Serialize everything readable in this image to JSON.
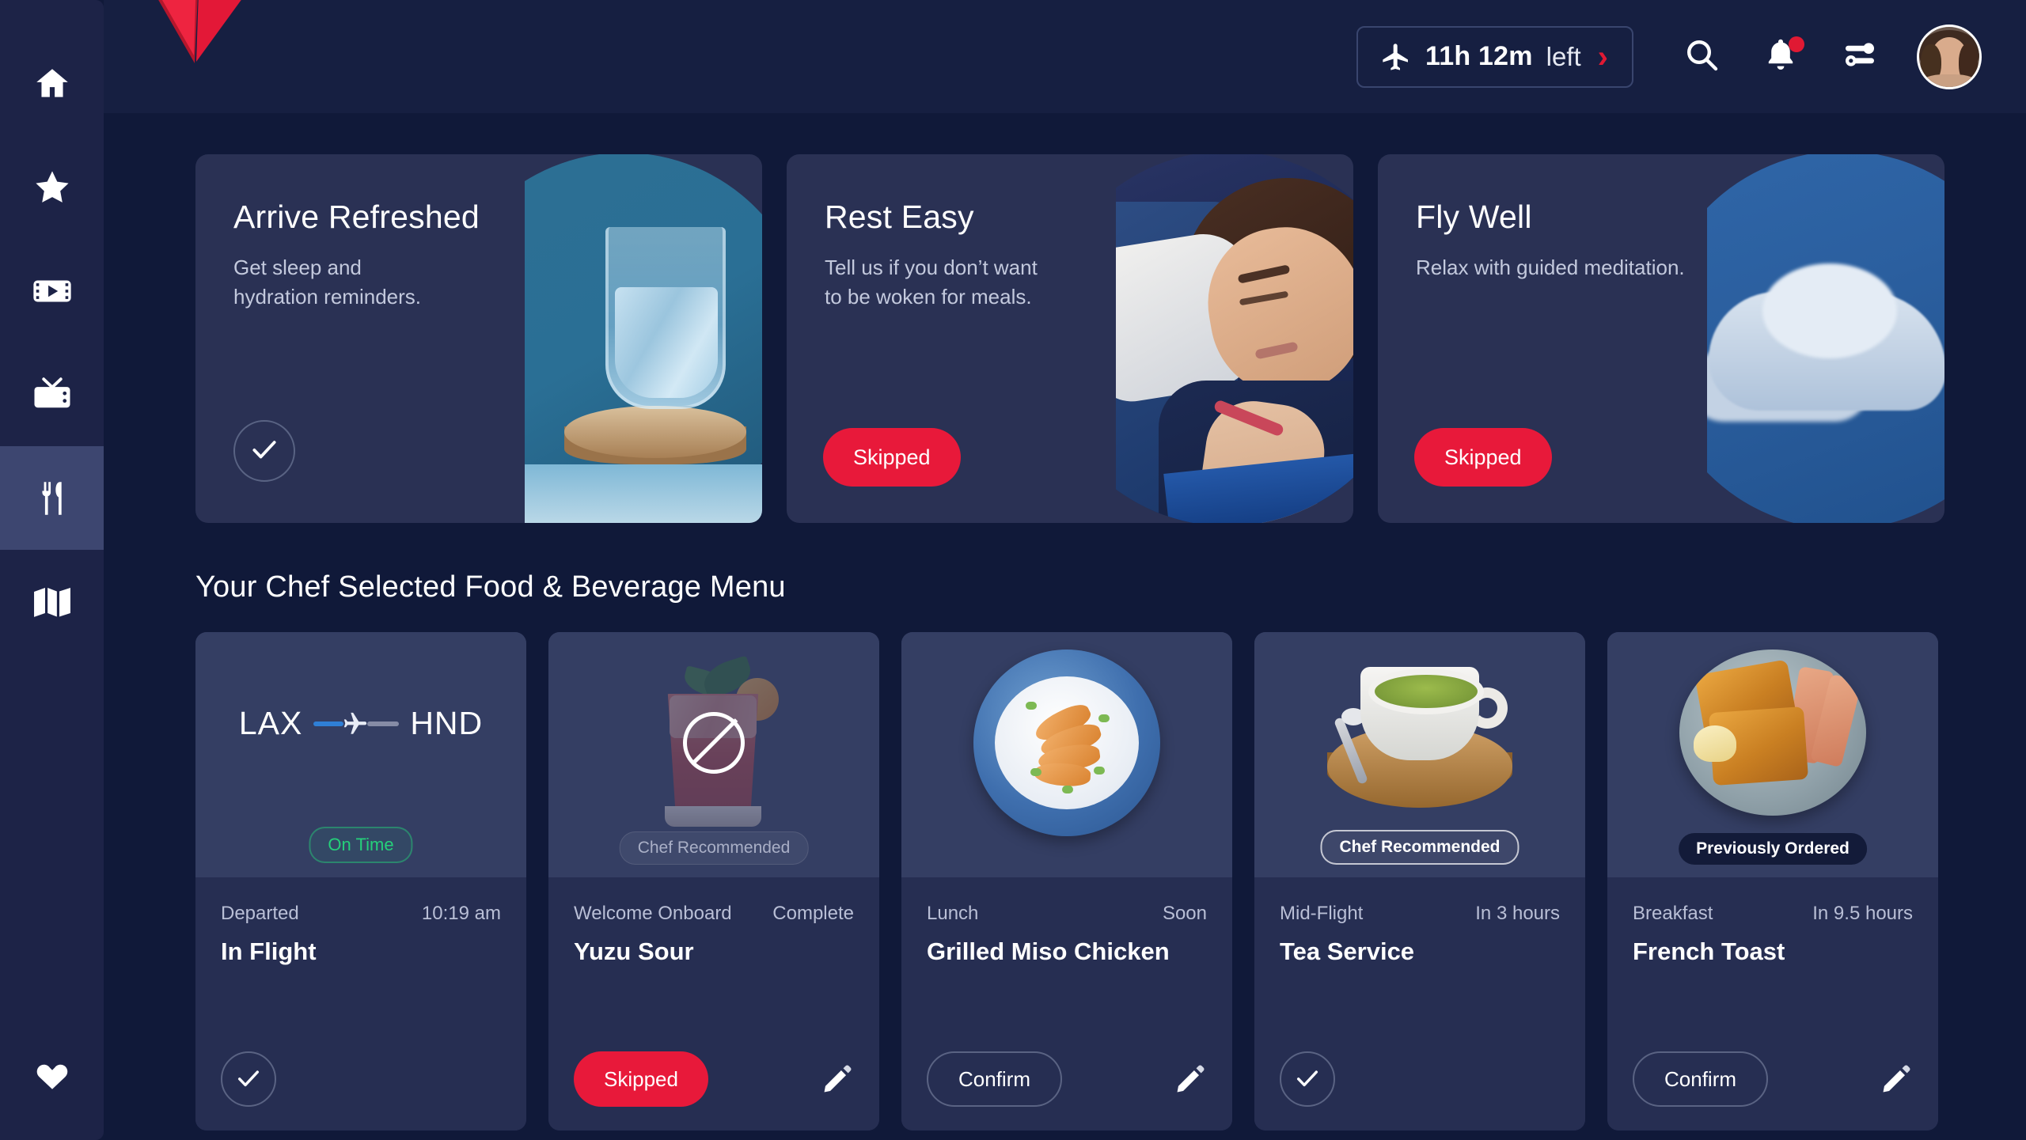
{
  "sidebar": {
    "items": [
      {
        "icon": "home-icon",
        "name": "home",
        "active": false
      },
      {
        "icon": "star-icon",
        "name": "favorites",
        "active": false
      },
      {
        "icon": "film-icon",
        "name": "movies",
        "active": false
      },
      {
        "icon": "tv-icon",
        "name": "tv",
        "active": false
      },
      {
        "icon": "cutlery-icon",
        "name": "food-beverage",
        "active": true
      },
      {
        "icon": "map-icon",
        "name": "flight-map",
        "active": false
      }
    ],
    "bottom": {
      "icon": "heart-icon",
      "name": "wishlist"
    }
  },
  "header": {
    "logo": "delta-widget-logo",
    "flight_status": {
      "icon": "airplane-icon",
      "time_remaining": "11h 12m",
      "suffix": "left",
      "chevron": "chevron-right-icon"
    },
    "actions": [
      {
        "icon": "search-icon",
        "name": "search"
      },
      {
        "icon": "bell-icon",
        "name": "notifications",
        "has_badge": true
      },
      {
        "icon": "sliders-icon",
        "name": "settings"
      }
    ],
    "avatar": "user-avatar"
  },
  "wellness_cards": [
    {
      "title": "Arrive Refreshed",
      "subtitle": "Get sleep and\nhydration reminders.",
      "action_type": "check",
      "action_label": "",
      "art": "water-glass"
    },
    {
      "title": "Rest Easy",
      "subtitle": "Tell us if you don’t want\nto be woken for meals.",
      "action_type": "skipped",
      "action_label": "Skipped",
      "art": "sleeping-passenger"
    },
    {
      "title": "Fly Well",
      "subtitle": "Relax with guided meditation.",
      "action_type": "skipped",
      "action_label": "Skipped",
      "art": "sky-cloud"
    }
  ],
  "menu_section": {
    "title": "Your Chef Selected Food & Beverage Menu"
  },
  "menu_cards": [
    {
      "kind": "flight-status",
      "origin": "LAX",
      "destination": "HND",
      "badge": {
        "text": "On Time",
        "style": "ontime"
      },
      "label": "Departed",
      "when": "10:19 am",
      "name": "In Flight",
      "action_type": "check",
      "action_label": "",
      "has_edit": false
    },
    {
      "kind": "item",
      "art": "cocktail",
      "dimmed": true,
      "overlay": "no-symbol-icon",
      "badge": {
        "text": "Chef Recommended",
        "style": "chef-dim"
      },
      "label": "Welcome Onboard",
      "when": "Complete",
      "name": "Yuzu Sour",
      "action_type": "skipped",
      "action_label": "Skipped",
      "has_edit": true
    },
    {
      "kind": "item",
      "art": "chicken-rice-bowl",
      "dimmed": false,
      "badge": null,
      "label": "Lunch",
      "when": "Soon",
      "name": "Grilled Miso Chicken",
      "action_type": "confirm",
      "action_label": "Confirm",
      "has_edit": true
    },
    {
      "kind": "item",
      "art": "tea-cup",
      "dimmed": false,
      "badge": {
        "text": "Chef Recommended",
        "style": "chef"
      },
      "label": "Mid-Flight",
      "when": "In 3 hours",
      "name": "Tea Service",
      "action_type": "check",
      "action_label": "",
      "has_edit": false
    },
    {
      "kind": "item",
      "art": "french-toast",
      "dimmed": false,
      "badge": {
        "text": "Previously Ordered",
        "style": "prev"
      },
      "label": "Breakfast",
      "when": "In 9.5 hours",
      "name": "French Toast",
      "action_type": "confirm",
      "action_label": "Confirm",
      "has_edit": true
    }
  ],
  "colors": {
    "page_bg": "#101939",
    "header_bg": "#161f41",
    "sidebar_bg": "#1d2347",
    "sidebar_active": "#3d4670",
    "wellness_card": "#2a3154",
    "menu_card_top": "#343e63",
    "menu_card_bottom": "#262e52",
    "accent_red": "#e8193a",
    "brand_red": "#e01933",
    "status_green": "#25d07a",
    "route_blue": "#2f7fd6"
  }
}
